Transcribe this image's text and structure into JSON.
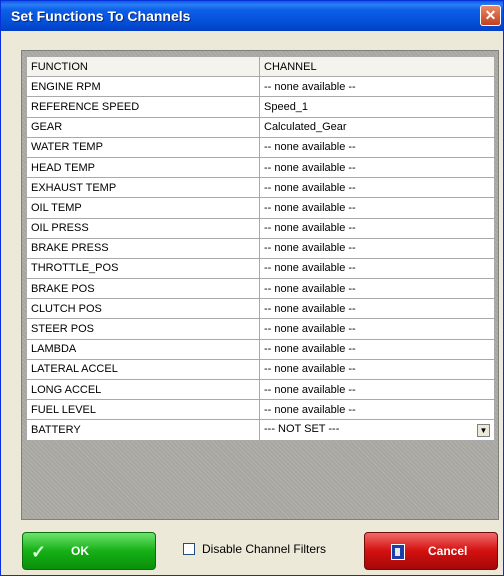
{
  "window": {
    "title": "Set Functions To Channels",
    "close_glyph": "✕"
  },
  "grid": {
    "headers": [
      "FUNCTION",
      "CHANNEL"
    ],
    "rows": [
      {
        "function": "ENGINE RPM",
        "channel": "-- none available --"
      },
      {
        "function": "REFERENCE SPEED",
        "channel": "Speed_1"
      },
      {
        "function": "GEAR",
        "channel": "Calculated_Gear"
      },
      {
        "function": "WATER TEMP",
        "channel": "-- none available --"
      },
      {
        "function": "HEAD TEMP",
        "channel": "-- none available --"
      },
      {
        "function": "EXHAUST TEMP",
        "channel": "-- none available --"
      },
      {
        "function": "OIL TEMP",
        "channel": "-- none available --"
      },
      {
        "function": "OIL  PRESS",
        "channel": "-- none available --"
      },
      {
        "function": "BRAKE PRESS",
        "channel": "-- none available --"
      },
      {
        "function": "THROTTLE_POS",
        "channel": "-- none available --"
      },
      {
        "function": "BRAKE POS",
        "channel": "-- none available --"
      },
      {
        "function": "CLUTCH  POS",
        "channel": "-- none available --"
      },
      {
        "function": "STEER POS",
        "channel": "-- none available --"
      },
      {
        "function": "LAMBDA",
        "channel": "-- none available --"
      },
      {
        "function": "LATERAL  ACCEL",
        "channel": "-- none available --"
      },
      {
        "function": "LONG ACCEL",
        "channel": "-- none available --"
      },
      {
        "function": "FUEL LEVEL",
        "channel": "-- none available --"
      },
      {
        "function": "BATTERY",
        "channel": "--- NOT SET ---",
        "dropdown": true
      }
    ]
  },
  "footer": {
    "ok_label": "OK",
    "cancel_label": "Cancel",
    "disable_filters_label": "Disable  Channel Filters",
    "disable_filters_checked": false
  },
  "icons": {
    "ok": "check-icon",
    "cancel": "exit-door-icon",
    "dropdown": "dropdown-arrow-icon"
  },
  "colors": {
    "ok_button": "#16b016",
    "cancel_button": "#d41010",
    "titlebar": "#0450d8"
  }
}
